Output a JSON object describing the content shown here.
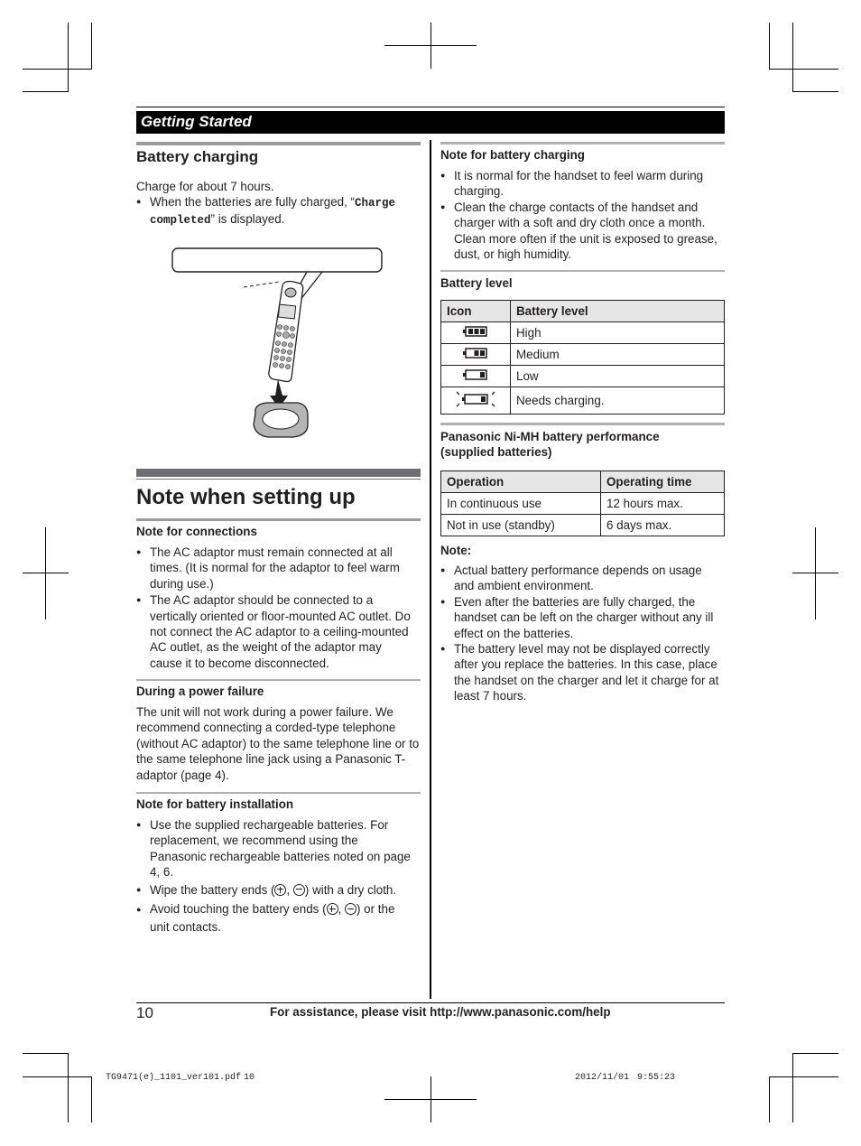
{
  "header": {
    "section_title": "Getting Started"
  },
  "battery_charging": {
    "title": "Battery charging",
    "intro": "Charge for about 7 hours.",
    "bullet_prefix": "When the batteries are fully charged, “",
    "display_text": "Charge completed",
    "bullet_suffix": "” is displayed.",
    "illustration": "handset-on-charger-illustration"
  },
  "note_when_setting_up": {
    "title": "Note when setting up",
    "connections": {
      "title": "Note for connections",
      "bullets": [
        "The AC adaptor must remain connected at all times. (It is normal for the adaptor to feel warm during use.)",
        "The AC adaptor should be connected to a vertically oriented or floor-mounted AC outlet. Do not connect the AC adaptor to a ceiling-mounted AC outlet, as the weight of the adaptor may cause it to become disconnected."
      ]
    },
    "power_failure": {
      "title": "During a power failure",
      "text": "The unit will not work during a power failure. We recommend connecting a corded-type telephone (without AC adaptor) to the same telephone line or to the same telephone line jack using a Panasonic T-adaptor (page 4)."
    },
    "battery_installation": {
      "title": "Note for battery installation",
      "bullet1": "Use the supplied rechargeable batteries. For replacement, we recommend using the Panasonic rechargeable batteries noted on page 4, 6.",
      "bullet2_pre": "Wipe the battery ends (",
      "bullet2_post": ") with a dry cloth.",
      "bullet3_pre": "Avoid touching the battery ends (",
      "bullet3_post": ") or the unit contacts.",
      "separator": ", "
    }
  },
  "battery_notes": {
    "title": "Note for battery charging",
    "bullets": [
      "It is normal for the handset to feel warm during charging.",
      "Clean the charge contacts of the handset and charger with a soft and dry cloth once a month. Clean more often if the unit is exposed to grease, dust, or high humidity."
    ]
  },
  "battery_level": {
    "title": "Battery level",
    "headers": [
      "Icon",
      "Battery level"
    ],
    "rows": [
      {
        "icon": "battery-full-icon",
        "bars": 3,
        "level": "High"
      },
      {
        "icon": "battery-medium-icon",
        "bars": 2,
        "level": "Medium"
      },
      {
        "icon": "battery-low-icon",
        "bars": 1,
        "level": "Low"
      },
      {
        "icon": "battery-flashing-icon",
        "bars": 1,
        "level": "Needs charging."
      }
    ]
  },
  "performance": {
    "title": "Panasonic Ni-MH battery performance (supplied batteries)",
    "headers": [
      "Operation",
      "Operating time"
    ],
    "rows": [
      [
        "In continuous use",
        "12 hours max."
      ],
      [
        "Not in use (standby)",
        "6 days max."
      ]
    ]
  },
  "note": {
    "title": "Note:",
    "bullets": [
      "Actual battery performance depends on usage and ambient environment.",
      "Even after the batteries are fully charged, the handset can be left on the charger without any ill effect on the batteries.",
      "The battery level may not be displayed correctly after you replace the batteries. In this case, place the handset on the charger and let it charge for at least 7 hours."
    ]
  },
  "footer": {
    "page_number": "10",
    "assistance": "For assistance, please visit http://www.panasonic.com/help"
  },
  "slug": {
    "file": "TG9471(e)_1101_ver101.pdf",
    "page": "10",
    "date": "2012/11/01",
    "time": "9:55:23"
  }
}
